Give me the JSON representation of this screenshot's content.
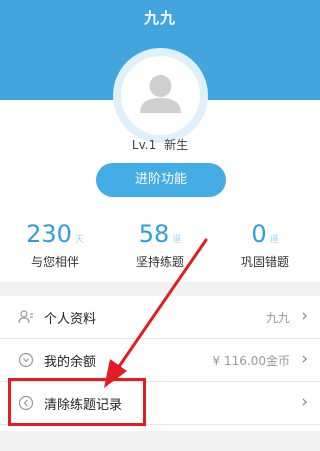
{
  "header": {
    "name": "九九"
  },
  "profile": {
    "level": "Lv.1",
    "level_title": "新生",
    "advance_button": "进阶功能"
  },
  "stats": [
    {
      "value": "230",
      "unit": "天",
      "label": "与您相伴"
    },
    {
      "value": "58",
      "unit": "道",
      "label": "坚持练题"
    },
    {
      "value": "0",
      "unit": "道",
      "label": "巩固错题"
    }
  ],
  "menu": {
    "profile": {
      "label": "个人资料",
      "value": "九九"
    },
    "balance": {
      "label": "我的余额",
      "value": "¥ 116.00金币"
    },
    "clear": {
      "label": "清除练题记录"
    }
  },
  "icons": {
    "avatar": "user-silhouette-icon",
    "profile": "person-card-icon",
    "balance": "coin-icon",
    "clear": "clear-icon",
    "chevron": "chevron-right-icon"
  },
  "colors": {
    "header": "#42a5e0",
    "accent": "#2b9fe0",
    "annotation": "#e31c23"
  }
}
